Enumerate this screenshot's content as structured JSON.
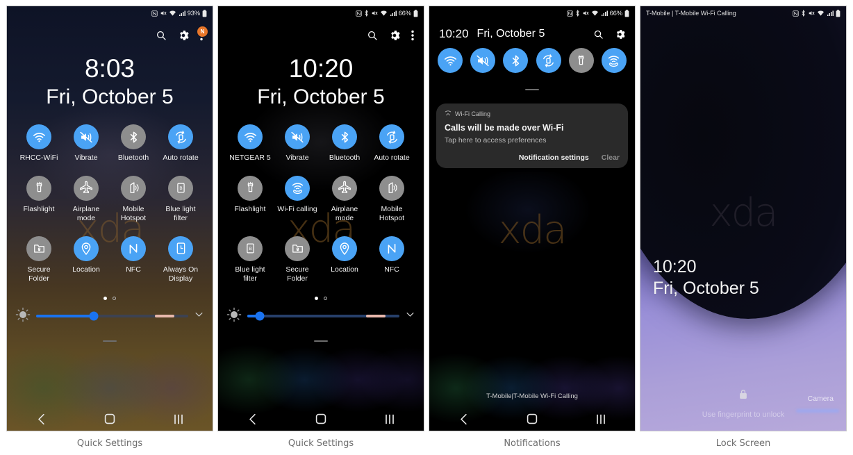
{
  "captions": [
    "Quick Settings",
    "Quick Settings",
    "Notifications",
    "Lock Screen"
  ],
  "colors": {
    "tile_on": "#4aa3f5",
    "tile_off": "#8e8e8e",
    "badge": "#e8762a",
    "slider": "#1a73f0",
    "caption_text": "#6d6d6d"
  },
  "panel1": {
    "statusbar": {
      "carrier": "",
      "icons": [
        "nfc-icon",
        "mute-icon",
        "wifi-icon",
        "signal-icon"
      ],
      "battery_text": "93%",
      "battery_icon": "battery-icon"
    },
    "header": {
      "search": "search-icon",
      "settings": "gear-icon",
      "more": "more-icon",
      "badge_text": "N"
    },
    "clock": {
      "time": "8:03",
      "date": "Fri, October 5"
    },
    "tiles": [
      {
        "label": "RHCC-WiFi",
        "icon": "wifi-icon",
        "state": "on"
      },
      {
        "label": "Vibrate",
        "icon": "vibrate-icon",
        "state": "on"
      },
      {
        "label": "Bluetooth",
        "icon": "bluetooth-icon",
        "state": "off"
      },
      {
        "label": "Auto rotate",
        "icon": "auto-rotate-icon",
        "state": "on"
      },
      {
        "label": "Flashlight",
        "icon": "flashlight-icon",
        "state": "off"
      },
      {
        "label": "Airplane mode",
        "icon": "airplane-icon",
        "state": "off"
      },
      {
        "label": "Mobile Hotspot",
        "icon": "hotspot-icon",
        "state": "off"
      },
      {
        "label": "Blue light filter",
        "icon": "blue-light-icon",
        "state": "off"
      },
      {
        "label": "Secure Folder",
        "icon": "secure-folder-icon",
        "state": "off"
      },
      {
        "label": "Location",
        "icon": "location-icon",
        "state": "on"
      },
      {
        "label": "NFC",
        "icon": "nfc-icon",
        "state": "on"
      },
      {
        "label": "Always On Display",
        "icon": "always-on-display-icon",
        "state": "on"
      }
    ],
    "pages": {
      "current": 1,
      "total": 2
    },
    "brightness": {
      "percent": 38,
      "auto_icon": "brightness-icon",
      "expand_icon": "chevron-down-icon"
    },
    "watermark": "xda",
    "nav": [
      "back-icon",
      "home-icon",
      "recents-icon"
    ]
  },
  "panel2": {
    "statusbar": {
      "carrier": "",
      "icons": [
        "nfc-icon",
        "bluetooth-icon",
        "mute-icon",
        "wifi-icon",
        "signal-icon"
      ],
      "battery_text": "66%",
      "battery_icon": "battery-icon"
    },
    "header": {
      "search": "search-icon",
      "settings": "gear-icon",
      "more": "more-icon",
      "badge_text": ""
    },
    "clock": {
      "time": "10:20",
      "date": "Fri, October 5"
    },
    "tiles": [
      {
        "label": "NETGEAR 5",
        "icon": "wifi-icon",
        "state": "on"
      },
      {
        "label": "Vibrate",
        "icon": "vibrate-icon",
        "state": "on"
      },
      {
        "label": "Bluetooth",
        "icon": "bluetooth-icon",
        "state": "on"
      },
      {
        "label": "Auto rotate",
        "icon": "auto-rotate-icon",
        "state": "on"
      },
      {
        "label": "Flashlight",
        "icon": "flashlight-icon",
        "state": "off"
      },
      {
        "label": "Wi-Fi calling",
        "icon": "wifi-calling-icon",
        "state": "on"
      },
      {
        "label": "Airplane mode",
        "icon": "airplane-icon",
        "state": "off"
      },
      {
        "label": "Mobile Hotspot",
        "icon": "hotspot-icon",
        "state": "off"
      },
      {
        "label": "Blue light filter",
        "icon": "blue-light-icon",
        "state": "off"
      },
      {
        "label": "Secure Folder",
        "icon": "secure-folder-icon",
        "state": "off"
      },
      {
        "label": "Location",
        "icon": "location-icon",
        "state": "on"
      },
      {
        "label": "NFC",
        "icon": "nfc-icon",
        "state": "on"
      }
    ],
    "pages": {
      "current": 1,
      "total": 2
    },
    "brightness": {
      "percent": 8,
      "auto_icon": "brightness-icon",
      "expand_icon": "chevron-down-icon"
    },
    "watermark": "xda",
    "nav": [
      "back-icon",
      "home-icon",
      "recents-icon"
    ]
  },
  "panel3": {
    "statusbar": {
      "carrier": "",
      "icons": [
        "nfc-icon",
        "bluetooth-icon",
        "mute-icon",
        "wifi-icon",
        "signal-icon"
      ],
      "battery_text": "66%",
      "battery_icon": "battery-icon"
    },
    "header": {
      "time": "10:20",
      "date": "Fri, October 5",
      "search": "search-icon",
      "settings": "gear-icon"
    },
    "tiles": [
      {
        "label": "Wi-Fi",
        "icon": "wifi-icon",
        "state": "on"
      },
      {
        "label": "Vibrate",
        "icon": "vibrate-icon",
        "state": "on"
      },
      {
        "label": "Bluetooth",
        "icon": "bluetooth-icon",
        "state": "on"
      },
      {
        "label": "Auto rotate",
        "icon": "auto-rotate-icon",
        "state": "on"
      },
      {
        "label": "Flashlight",
        "icon": "flashlight-icon",
        "state": "off"
      },
      {
        "label": "Wi-Fi calling",
        "icon": "wifi-calling-icon",
        "state": "on"
      }
    ],
    "notification": {
      "app": "Wi-Fi Calling",
      "app_icon": "wifi-calling-icon",
      "title": "Calls will be made over Wi-Fi",
      "subtitle": "Tap here to access preferences",
      "action_settings": "Notification settings",
      "action_clear": "Clear"
    },
    "carrier_line": "T-Mobile|T-Mobile Wi-Fi Calling",
    "watermark": "xda",
    "nav": [
      "back-icon",
      "home-icon",
      "recents-icon"
    ]
  },
  "panel4": {
    "statusbar": {
      "carrier": "T-Mobile | T-Mobile Wi-Fi Calling",
      "icons": [
        "nfc-icon",
        "bluetooth-icon",
        "mute-icon",
        "wifi-icon",
        "signal-icon"
      ],
      "battery_text": "",
      "battery_icon": "battery-icon"
    },
    "clock": {
      "time": "10:20",
      "date": "Fri, October 5"
    },
    "lock_icon": "lock-icon",
    "hint": "Use fingerprint to unlock",
    "camera": "Camera",
    "watermark": "xda"
  }
}
